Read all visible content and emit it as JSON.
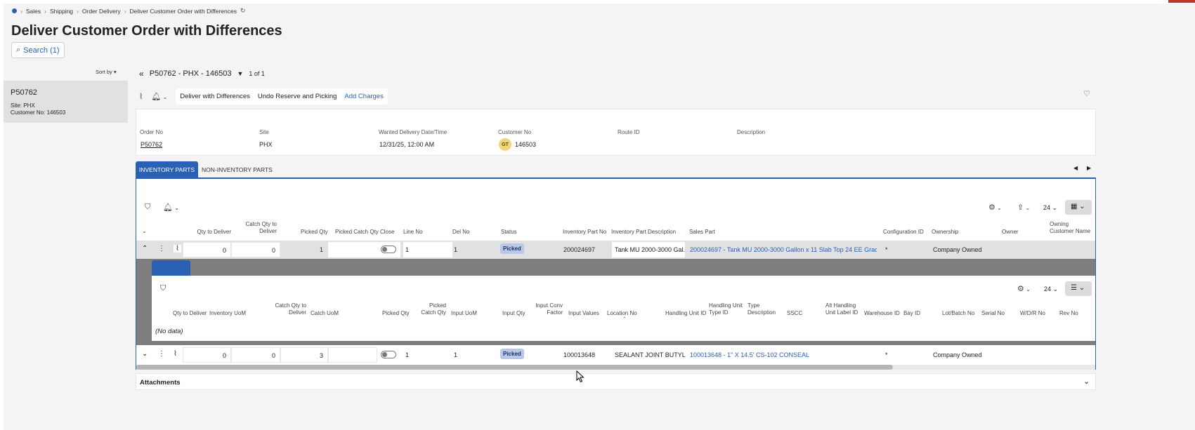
{
  "breadcrumb": [
    "Sales",
    "Shipping",
    "Order Delivery",
    "Deliver Customer Order with Differences"
  ],
  "page_title": "Deliver Customer Order with Differences",
  "search_label": "Search (1)",
  "left_panel": {
    "sort_label": "Sort by",
    "card": {
      "title": "P50762",
      "site_line": "Site:   PHX",
      "customer_line": "Customer No:   146503"
    }
  },
  "record_nav": {
    "record_label": "P50762 - PHX - 146503",
    "counter": "1 of 1"
  },
  "toolbar": {
    "commands": [
      "Deliver with Differences",
      "Undo Reserve and Picking",
      "Add Charges"
    ]
  },
  "header_fields": [
    {
      "label": "Order No",
      "value": "P50762"
    },
    {
      "label": "Site",
      "value": "PHX"
    },
    {
      "label": "Wanted Delivery Date/Time",
      "value": "12/31/25, 12:00 AM"
    },
    {
      "label": "Customer No",
      "value": "146503",
      "avatar": "GT"
    },
    {
      "label": "Route ID",
      "value": ""
    },
    {
      "label": "Description",
      "value": ""
    }
  ],
  "tabs": [
    "INVENTORY PARTS",
    "NON-INVENTORY PARTS"
  ],
  "grid_toolbar": {
    "page_size": "24"
  },
  "columns": [
    "Qty to Deliver",
    "Catch Qty to Deliver",
    "Picked Qty",
    "Picked Catch Qty",
    "Close",
    "Line No",
    "Del No",
    "Status",
    "Inventory Part No",
    "Inventory Part Description",
    "Sales Part",
    "Configuration ID",
    "Ownership",
    "Owner",
    "Owning Customer Name"
  ],
  "rows": [
    {
      "qty_to_deliver": "0",
      "catch_qty": "0",
      "picked_qty": "1",
      "line_no": "1",
      "del_no": "1",
      "status": "Picked",
      "inventory_part_no": "200024697",
      "description": "Tank MU 2000-3000 Gal...",
      "sales_part": "200024697 - Tank MU 2000-3000 Gallon x 11 Slab Top 24 EE Grade...",
      "configuration_id": "*",
      "ownership": "Company Owned"
    },
    {
      "qty_to_deliver": "0",
      "catch_qty": "0",
      "picked_qty": "3",
      "line_no": "1",
      "del_no": "1",
      "status": "Picked",
      "inventory_part_no": "100013648",
      "description": "SEALANT JOINT BUTYL ...",
      "sales_part": "100013648 - 1\" X 14.5' CS-102 CONSEAL",
      "configuration_id": "*",
      "ownership": "Company Owned"
    }
  ],
  "detail": {
    "page_size": "24",
    "columns": [
      "Qty to Deliver",
      "Inventory UoM",
      "Catch Qty to Deliver",
      "Catch UoM",
      "Picked Qty",
      "Picked Catch Qty",
      "Input UoM",
      "Input Qty",
      "Input Conv Factor",
      "Input Values",
      "Location No",
      "Handling Unit ID",
      "Handling Unit Type ID",
      "Type Description",
      "SSCC",
      "Alt Handling Unit Label ID",
      "Warehouse ID",
      "Bay ID",
      "Lot/Batch No",
      "Serial No",
      "W/D/R No",
      "Rev No"
    ],
    "empty_text": "(No data)"
  },
  "attachments_label": "Attachments",
  "colors": {
    "accent": "#2a61b5",
    "badge": "#b9c8e8",
    "corner": "#c0392b"
  }
}
